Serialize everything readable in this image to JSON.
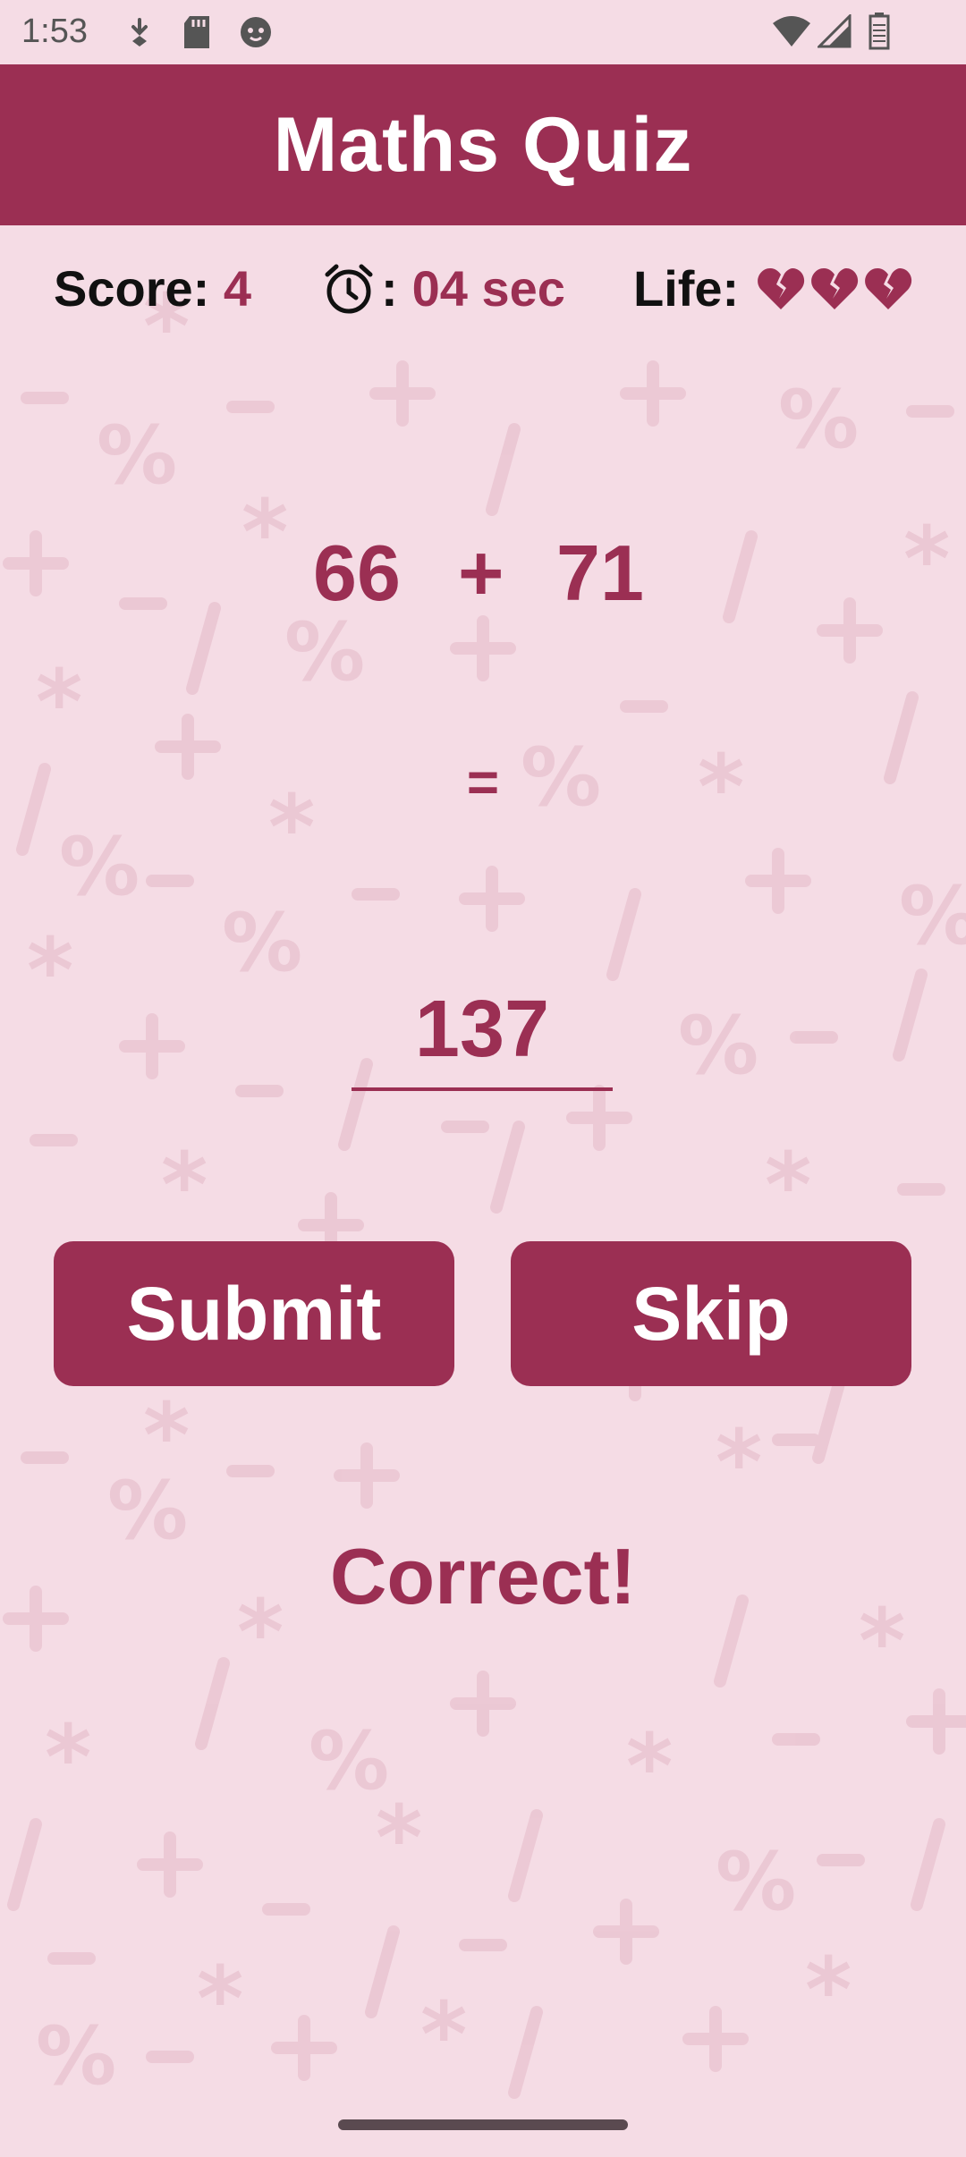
{
  "status_bar": {
    "time": "1:53",
    "icons": [
      "download-icon",
      "sd-card-icon",
      "cat-face-icon",
      "wifi-icon",
      "signal-icon",
      "battery-icon"
    ]
  },
  "app_bar": {
    "title": "Maths Quiz"
  },
  "stats": {
    "score_label": "Score:",
    "score_value": "4",
    "timer_label": ":",
    "timer_value": "04 sec",
    "life_label": "Life:",
    "lives_icons": [
      "broken-heart-icon",
      "broken-heart-icon",
      "broken-heart-icon"
    ]
  },
  "question": {
    "operand1": "66",
    "operator": "+",
    "operand2": "71",
    "equals": "="
  },
  "answer_input": {
    "value": "137"
  },
  "buttons": {
    "submit": "Submit",
    "skip": "Skip"
  },
  "feedback": "Correct!",
  "colors": {
    "primary": "#9b2f53",
    "background": "#f5dce5",
    "pattern": "#ebc6d3"
  }
}
